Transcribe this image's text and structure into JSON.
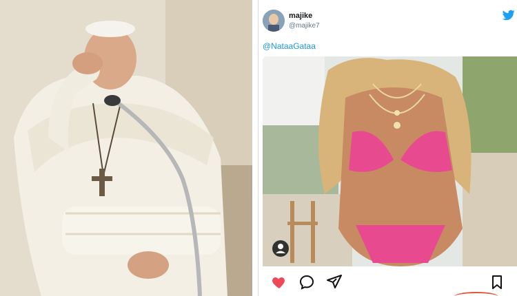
{
  "tweet": {
    "display_name": "majike",
    "handle": "@majike7",
    "mention": "@NataaGataa"
  },
  "icons": {
    "brand": "twitter-bird-icon",
    "like": "heart-icon",
    "comment": "comment-icon",
    "share": "send-icon",
    "save": "bookmark-icon",
    "tag": "user-tag-icon"
  },
  "colors": {
    "twitter_blue": "#1da1f2",
    "mention": "#1b95e0",
    "like_red": "#ed4956"
  }
}
